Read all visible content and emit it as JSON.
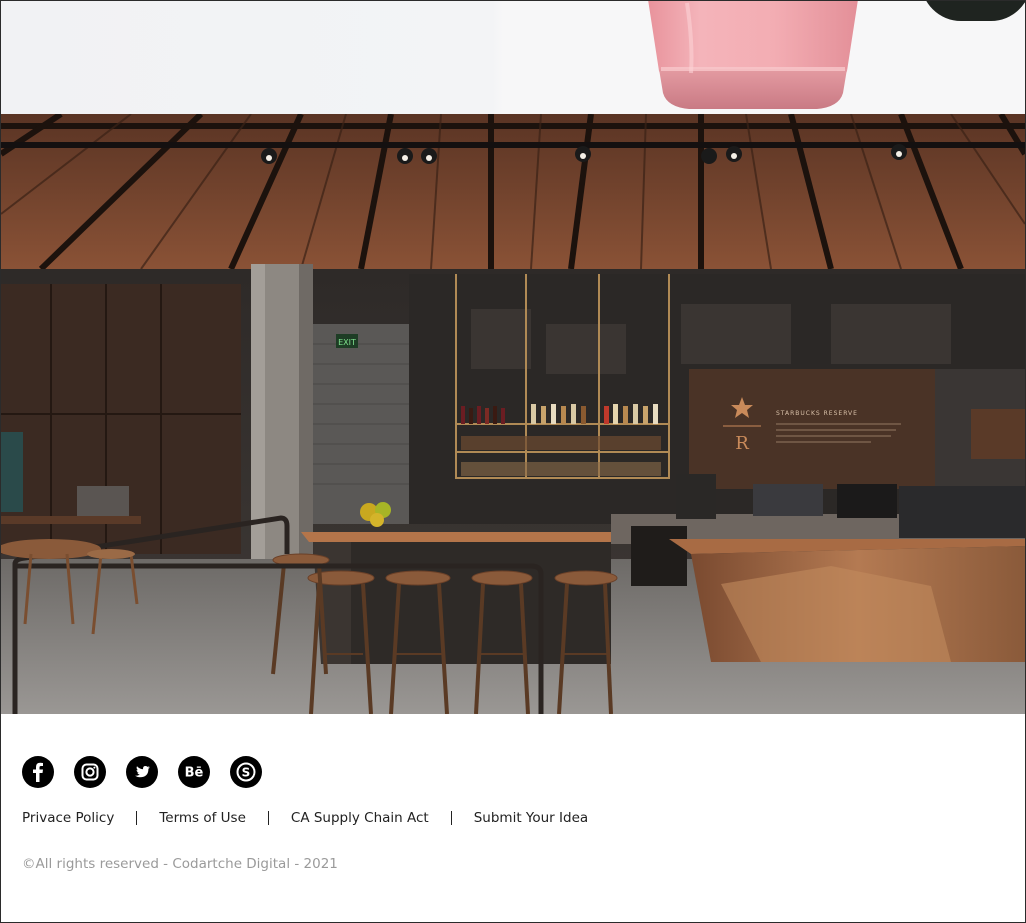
{
  "footer": {
    "social_icons": [
      {
        "name": "facebook-icon",
        "glyph": "f"
      },
      {
        "name": "instagram-icon",
        "glyph": "instagram"
      },
      {
        "name": "twitter-icon",
        "glyph": "bird"
      },
      {
        "name": "behance-icon",
        "glyph": "Bē"
      },
      {
        "name": "skype-icon",
        "glyph": "S"
      }
    ],
    "links": [
      {
        "label": "Privace Policy"
      },
      {
        "label": "Terms of Use"
      },
      {
        "label": "CA Supply Chain Act"
      },
      {
        "label": "Submit Your Idea"
      }
    ],
    "copyright": "©All rights reserved - Codartche Digital - 2021"
  },
  "photo": {
    "exit_sign": "EXIT",
    "brand_sign_title": "STARBUCKS RESERVE",
    "brand_letter": "R"
  },
  "colors": {
    "social_icon_bg": "#000000",
    "link_text": "#222222",
    "copyright_text": "#9a9a9a",
    "drink_pink": "#f1a7ae"
  }
}
